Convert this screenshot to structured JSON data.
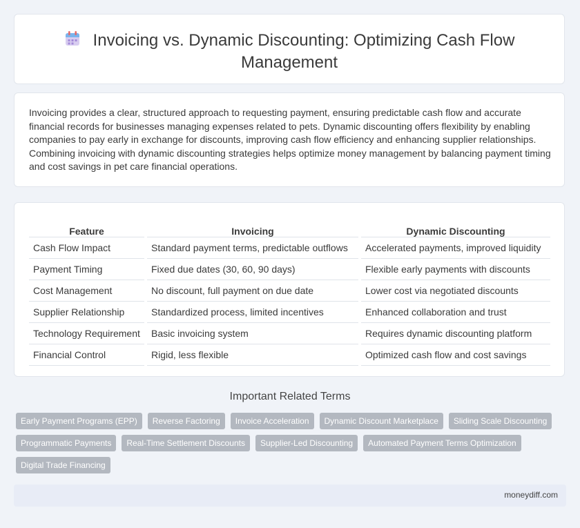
{
  "header": {
    "icon": "calendar-icon",
    "title": "Invoicing vs. Dynamic Discounting: Optimizing Cash Flow Management"
  },
  "intro": "Invoicing provides a clear, structured approach to requesting payment, ensuring predictable cash flow and accurate financial records for businesses managing expenses related to pets. Dynamic discounting offers flexibility by enabling companies to pay early in exchange for discounts, improving cash flow efficiency and enhancing supplier relationships. Combining invoicing with dynamic discounting strategies helps optimize money management by balancing payment timing and cost savings in pet care financial operations.",
  "table": {
    "headers": [
      "Feature",
      "Invoicing",
      "Dynamic Discounting"
    ],
    "rows": [
      [
        "Cash Flow Impact",
        "Standard payment terms, predictable outflows",
        "Accelerated payments, improved liquidity"
      ],
      [
        "Payment Timing",
        "Fixed due dates (30, 60, 90 days)",
        "Flexible early payments with discounts"
      ],
      [
        "Cost Management",
        "No discount, full payment on due date",
        "Lower cost via negotiated discounts"
      ],
      [
        "Supplier Relationship",
        "Standardized process, limited incentives",
        "Enhanced collaboration and trust"
      ],
      [
        "Technology Requirement",
        "Basic invoicing system",
        "Requires dynamic discounting platform"
      ],
      [
        "Financial Control",
        "Rigid, less flexible",
        "Optimized cash flow and cost savings"
      ]
    ]
  },
  "related": {
    "title": "Important Related Terms",
    "tags": [
      "Early Payment Programs (EPP)",
      "Reverse Factoring",
      "Invoice Acceleration",
      "Dynamic Discount Marketplace",
      "Sliding Scale Discounting",
      "Programmatic Payments",
      "Real-Time Settlement Discounts",
      "Supplier-Led Discounting",
      "Automated Payment Terms Optimization",
      "Digital Trade Financing"
    ]
  },
  "footer": {
    "site": "moneydiff.com"
  },
  "colors": {
    "background": "#f0f3f8",
    "tag": "#b3b8c0",
    "footer": "#e8ecf6"
  }
}
